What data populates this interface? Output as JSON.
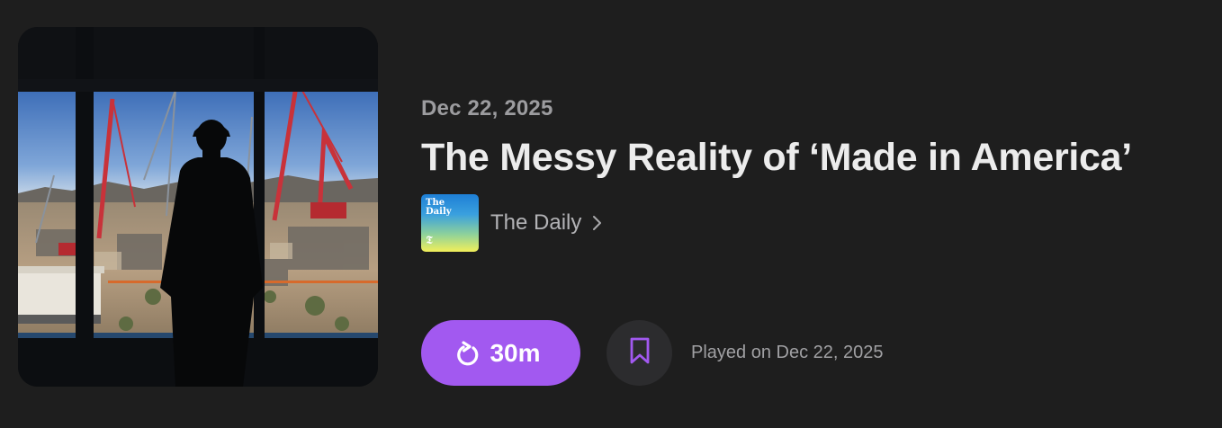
{
  "episode": {
    "date": "Dec 22, 2025",
    "title": "The Messy Reality of ‘Made in America’"
  },
  "show": {
    "name": "The Daily",
    "thumb_text": "The Daily",
    "thumb_logo": "𝕿"
  },
  "actions": {
    "play_duration": "30m",
    "played_status": "Played on Dec 22, 2025"
  },
  "icons": {
    "play": "replay-icon",
    "bookmark": "bookmark-icon",
    "chevron": "chevron-right-icon"
  },
  "colors": {
    "accent": "#a259f0",
    "background": "#1e1e1e"
  }
}
